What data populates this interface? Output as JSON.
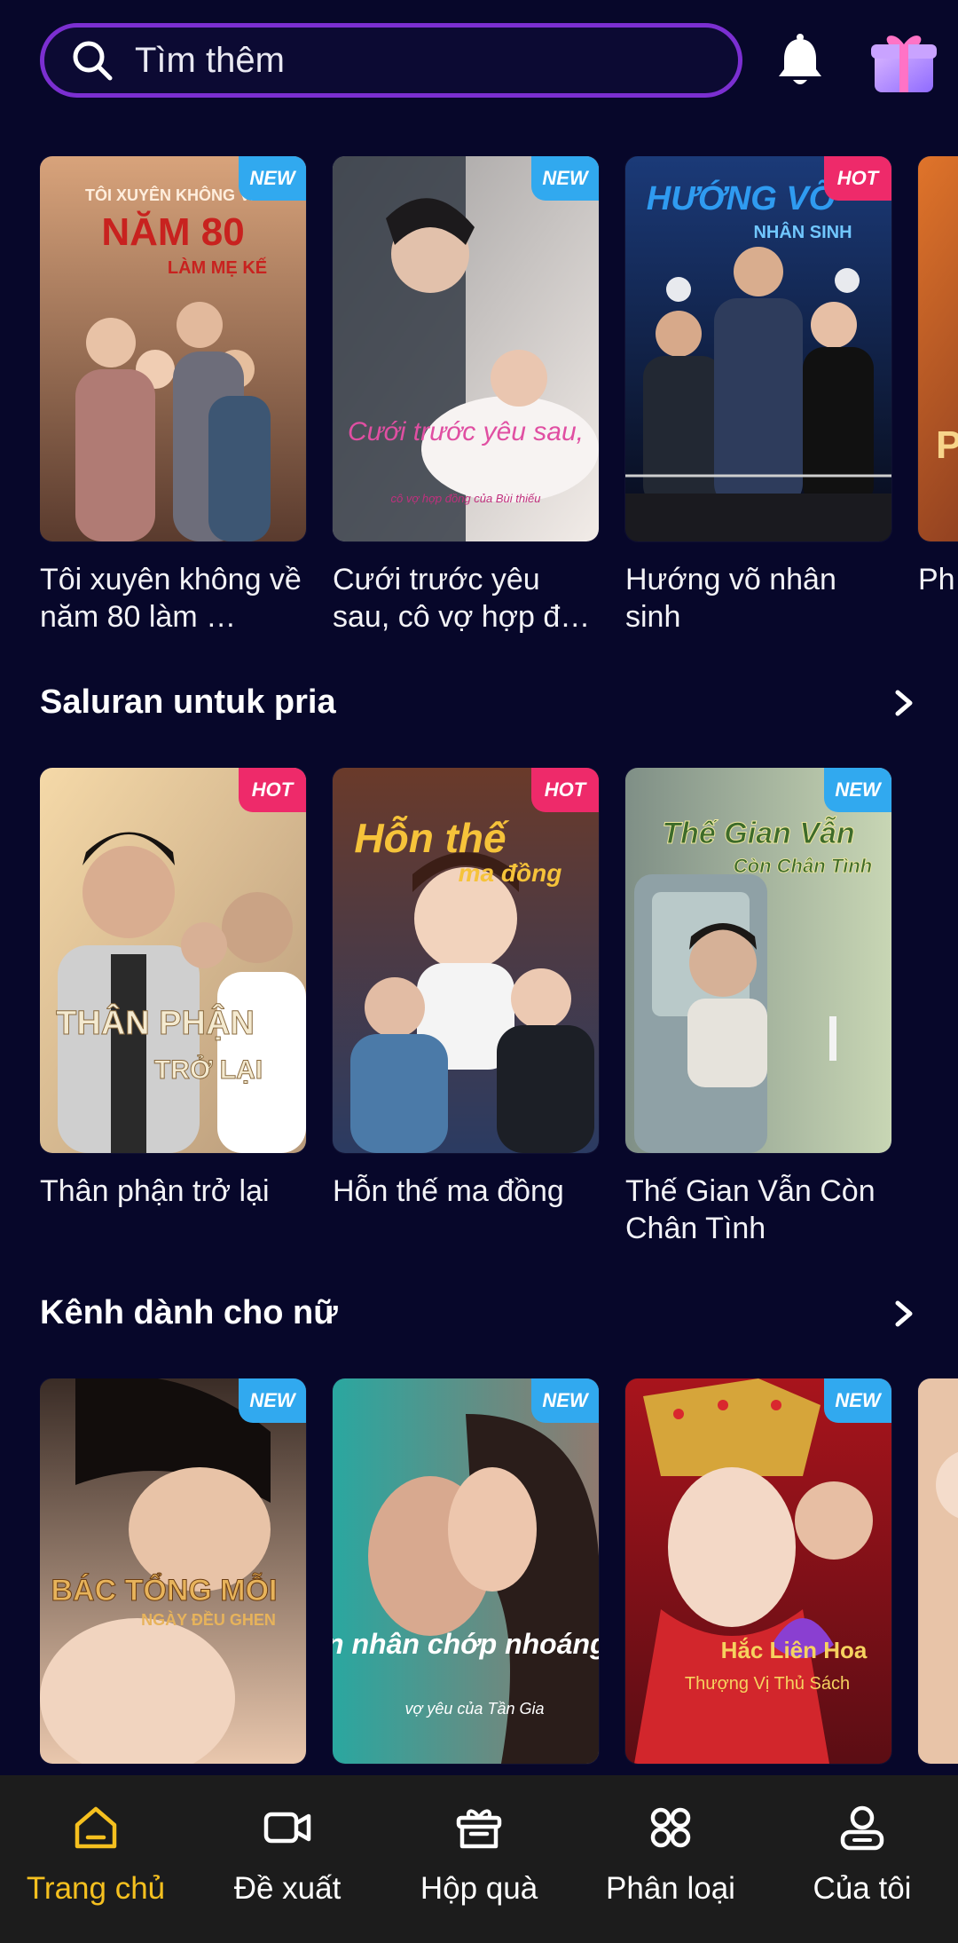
{
  "search": {
    "placeholder": "Tìm thêm"
  },
  "icons": {
    "search": "search-icon",
    "bell": "bell-icon",
    "gift": "gift-icon"
  },
  "row1": {
    "cards": [
      {
        "title": "Tôi xuyên không về năm 80 làm …",
        "badge": "NEW",
        "poster_title": "NĂM 80",
        "poster_sub": "TÔI XUYÊN KHÔNG VỀ",
        "poster_sub2": "LÀM MẸ KẾ"
      },
      {
        "title": "Cưới trước yêu sau, cô vợ hợp đ…",
        "badge": "NEW",
        "poster_title": "Cưới trước yêu sau,",
        "poster_sub": "cô vợ hợp đồng của Bùi thiếu"
      },
      {
        "title": "Hướng võ nhân sinh",
        "badge": "HOT",
        "poster_title": "HƯỚNG VÕ",
        "poster_sub": "NHÂN SINH"
      },
      {
        "title": "Ph Qu",
        "badge": "",
        "poster_title": "P"
      }
    ]
  },
  "sections": [
    {
      "title": "Saluran untuk pria"
    },
    {
      "title": "Kênh dành cho nữ"
    }
  ],
  "row2": {
    "cards": [
      {
        "title": "Thân phận trở lại",
        "badge": "HOT",
        "poster_title": "THÂN PHẬN",
        "poster_sub": "TRỞ LẠI"
      },
      {
        "title": "Hỗn thế ma đồng",
        "badge": "HOT",
        "poster_title": "Hỗn thế",
        "poster_sub": "ma đồng"
      },
      {
        "title": "Thế Gian Vẫn Còn Chân Tình",
        "badge": "NEW",
        "poster_title": "Thế Gian Vẫn",
        "poster_sub": "Còn Chân Tình"
      }
    ]
  },
  "row3": {
    "cards": [
      {
        "title": "",
        "badge": "NEW",
        "poster_title": "BÁC TỔNG MỖI",
        "poster_sub": "NGÀY ĐỀU GHEN"
      },
      {
        "title": "",
        "badge": "NEW",
        "poster_title": "Hôn nhân chớp nhoáng",
        "poster_sub": "vợ yêu của Tần Gia"
      },
      {
        "title": "",
        "badge": "NEW",
        "poster_title": "Hắc Liên Hoa",
        "poster_sub": "Thượng Vị Thủ Sách"
      }
    ]
  },
  "nav": {
    "items": [
      {
        "label": "Trang chủ",
        "icon": "home-icon",
        "active": true
      },
      {
        "label": "Đề xuất",
        "icon": "video-camera-icon",
        "active": false
      },
      {
        "label": "Hộp quà",
        "icon": "gift-box-icon",
        "active": false
      },
      {
        "label": "Phân loại",
        "icon": "category-grid-icon",
        "active": false
      },
      {
        "label": "Của tôi",
        "icon": "profile-icon",
        "active": false
      }
    ]
  },
  "colors": {
    "background": "#07072a",
    "accent": "#f5c01f",
    "search_border": "#7b2fd1",
    "badge_new": "#31a9ef",
    "badge_hot": "#ee2a6a",
    "nav_bg": "#1c1c1c"
  }
}
